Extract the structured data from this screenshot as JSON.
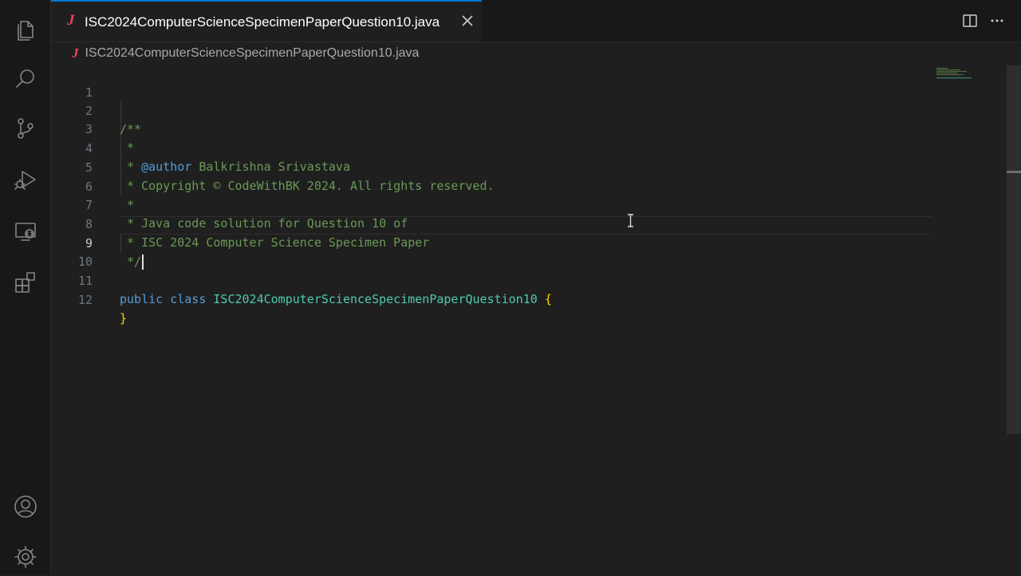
{
  "tab": {
    "icon": "java-file-icon",
    "icon_glyph": "J",
    "filename": "ISC2024ComputerScienceSpecimenPaperQuestion10.java",
    "close_icon": "close-icon"
  },
  "breadcrumb": {
    "icon_glyph": "J",
    "filename": "ISC2024ComputerScienceSpecimenPaperQuestion10.java"
  },
  "activity_bar": [
    "explorer-icon",
    "search-icon",
    "source-control-icon",
    "run-debug-icon",
    "remote-explorer-icon",
    "extensions-icon",
    "accounts-icon",
    "settings-gear-icon"
  ],
  "editor": {
    "active_line": 9,
    "line_numbers": [
      "1",
      "2",
      "3",
      "4",
      "5",
      "6",
      "7",
      "8",
      "9",
      "10",
      "11",
      "12"
    ],
    "lines": {
      "l2": "/**",
      "l3": " *",
      "l4_prefix": " * ",
      "l4_tag": "@author",
      "l4_rest": " Balkrishna Srivastava",
      "l5": " * Copyright © CodeWithBK 2024. All rights reserved.",
      "l6": " *",
      "l7": " * Java code solution for Question 10 of",
      "l8": " * ISC 2024 Computer Science Specimen Paper",
      "l9": " */",
      "l11_kw1": "public",
      "l11_kw2": "class",
      "l11_name": "ISC2024ComputerScienceSpecimenPaperQuestion10",
      "l11_brace": "{",
      "l12_brace": "}"
    }
  },
  "colors": {
    "accent": "#0078d4",
    "comment": "#6a9955",
    "keyword": "#569cd6",
    "class_name": "#4ec9b0",
    "brace": "#ffd700",
    "java_icon": "#e8455a"
  }
}
